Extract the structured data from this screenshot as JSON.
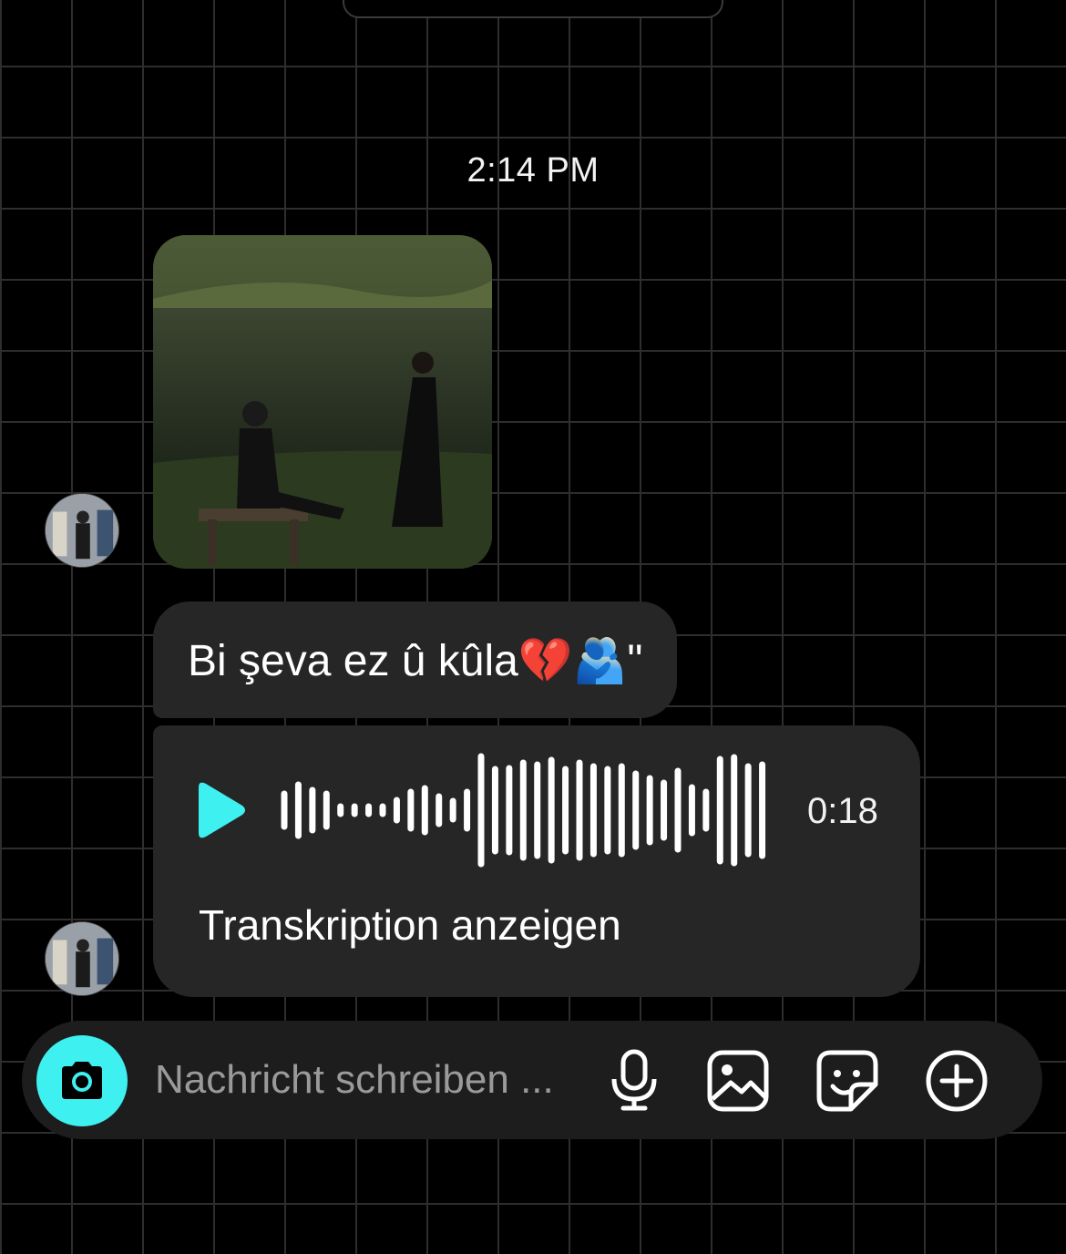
{
  "chat": {
    "timestamp": "2:14 PM",
    "photo_message": {
      "icon": "photo-image",
      "description_shown": ""
    },
    "text_message": {
      "text": "Bi şeva ez û kûla💔🫂\""
    },
    "voice_message": {
      "duration": "0:18",
      "transcription_label": "Transkription anzeigen",
      "accent_color": "#3ff0f0"
    }
  },
  "composer": {
    "placeholder": "Nachricht schreiben ...",
    "value": "",
    "icons": [
      "camera-icon",
      "microphone-icon",
      "gallery-icon",
      "sticker-icon",
      "plus-icon"
    ],
    "accent_color": "#3ff0f0"
  }
}
